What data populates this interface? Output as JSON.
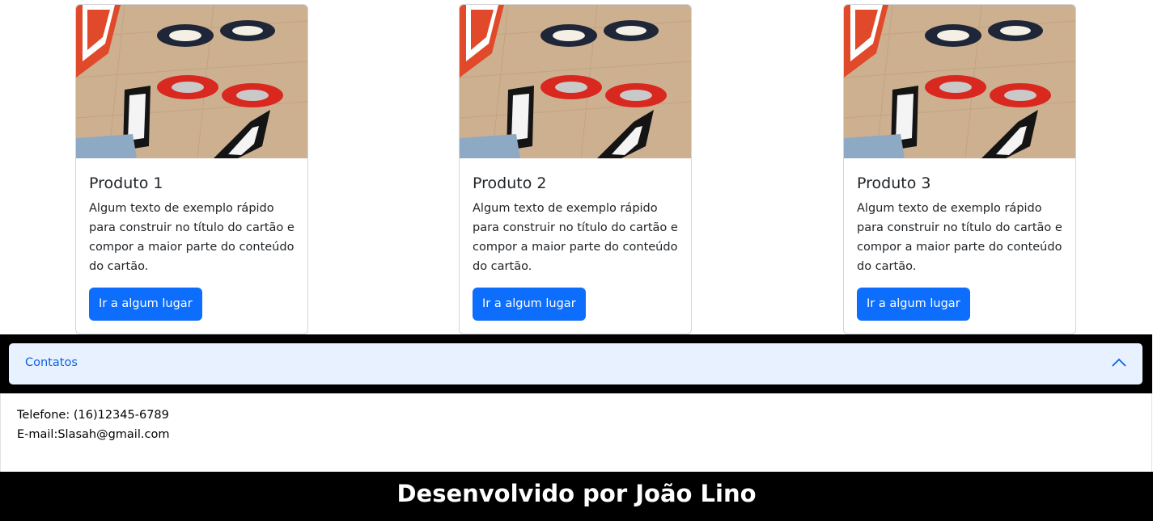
{
  "products": [
    {
      "title": "Produto 1",
      "text": "Algum texto de exemplo rápido para construir no título do cartão e compor a maior parte do conteúdo do cartão.",
      "button_label": "Ir a algum lugar",
      "image_icon": "sneakers-photo"
    },
    {
      "title": "Produto 2",
      "text": "Algum texto de exemplo rápido para construir no título do cartão e compor a maior parte do conteúdo do cartão.",
      "button_label": "Ir a algum lugar",
      "image_icon": "sneakers-photo"
    },
    {
      "title": "Produto 3",
      "text": "Algum texto de exemplo rápido para construir no título do cartão e compor a maior parte do conteúdo do cartão.",
      "button_label": "Ir a algum lugar",
      "image_icon": "sneakers-photo"
    }
  ],
  "accordion": {
    "label": "Contatos",
    "expanded": true,
    "icon": "chevron-up-icon",
    "phone": "Telefone: (16)12345-6789",
    "email": "E-mail:Slasah@gmail.com"
  },
  "footer": {
    "text": "Desenvolvido por João Lino"
  },
  "colors": {
    "primary_button": "#0d6efd",
    "accordion_active_bg": "#e7f1ff",
    "accordion_active_text": "#0c63e4",
    "footer_bg": "#000000",
    "footer_text": "#ffffff"
  }
}
